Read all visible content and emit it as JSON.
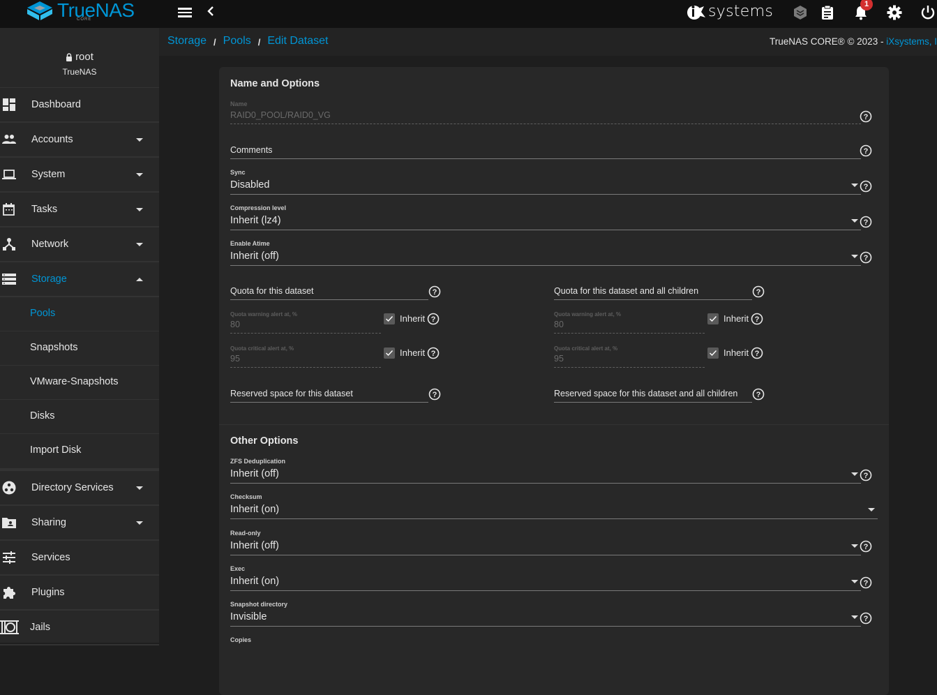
{
  "header": {
    "logo_text": "TrueNAS",
    "logo_sub": "CORE",
    "vendor_text": "systems",
    "notification_count": "1",
    "icons": [
      "menu-icon",
      "back-chevron-icon",
      "truecommand-icon",
      "clipboard-icon",
      "bell-icon",
      "gear-icon",
      "power-icon"
    ]
  },
  "breadcrumb": {
    "items": [
      "Storage",
      "Pools",
      "Edit Dataset"
    ],
    "separator": "/"
  },
  "copyright": {
    "text": "TrueNAS CORE® © 2023 - ",
    "link": "iXsystems, Inc"
  },
  "user": {
    "name": "root",
    "host": "TrueNAS"
  },
  "sidebar": {
    "items": [
      {
        "label": "Dashboard",
        "icon": "dashboard-icon",
        "expandable": false
      },
      {
        "label": "Accounts",
        "icon": "people-icon",
        "expandable": true
      },
      {
        "label": "System",
        "icon": "laptop-icon",
        "expandable": true
      },
      {
        "label": "Tasks",
        "icon": "calendar-icon",
        "expandable": true
      },
      {
        "label": "Network",
        "icon": "network-icon",
        "expandable": true
      },
      {
        "label": "Storage",
        "icon": "storage-icon",
        "expandable": true,
        "expanded": true,
        "active": true
      },
      {
        "label": "Directory Services",
        "icon": "directory-services-icon",
        "expandable": true
      },
      {
        "label": "Sharing",
        "icon": "folder-shared-icon",
        "expandable": true
      },
      {
        "label": "Services",
        "icon": "tune-icon",
        "expandable": false
      },
      {
        "label": "Plugins",
        "icon": "puzzle-icon",
        "expandable": false
      },
      {
        "label": "Jails",
        "icon": "jail-icon",
        "expandable": false
      }
    ],
    "storage_subitems": [
      {
        "label": "Pools",
        "active": true
      },
      {
        "label": "Snapshots"
      },
      {
        "label": "VMware-Snapshots"
      },
      {
        "label": "Disks"
      },
      {
        "label": "Import Disk"
      }
    ]
  },
  "form": {
    "section1_title": "Name and Options",
    "name": {
      "label": "Name",
      "value": "RAID0_POOL/RAID0_VG"
    },
    "comments": {
      "placeholder": "Comments",
      "value": ""
    },
    "sync": {
      "label": "Sync",
      "value": "Disabled"
    },
    "compression": {
      "label": "Compression level",
      "value": "Inherit (lz4)"
    },
    "atime": {
      "label": "Enable Atime",
      "value": "Inherit (off)"
    },
    "quota_left": {
      "placeholder": "Quota for this dataset",
      "warning": {
        "label": "Quota warning alert at, %",
        "value": "80",
        "inherit": true,
        "inherit_label": "Inherit"
      },
      "critical": {
        "label": "Quota critical alert at, %",
        "value": "95",
        "inherit": true,
        "inherit_label": "Inherit"
      },
      "reserved": {
        "placeholder": "Reserved space for this dataset"
      }
    },
    "quota_right": {
      "placeholder": "Quota for this dataset and all children",
      "warning": {
        "label": "Quota warning alert at, %",
        "value": "80",
        "inherit": true,
        "inherit_label": "Inherit"
      },
      "critical": {
        "label": "Quota critical alert at, %",
        "value": "95",
        "inherit": true,
        "inherit_label": "Inherit"
      },
      "reserved": {
        "placeholder": "Reserved space for this dataset and all children"
      }
    },
    "section2_title": "Other Options",
    "dedup": {
      "label": "ZFS Deduplication",
      "value": "Inherit (off)"
    },
    "checksum": {
      "label": "Checksum",
      "value": "Inherit (on)"
    },
    "readonly": {
      "label": "Read-only",
      "value": "Inherit (off)"
    },
    "exec": {
      "label": "Exec",
      "value": "Inherit (on)"
    },
    "snapdir": {
      "label": "Snapshot directory",
      "value": "Invisible"
    },
    "copies": {
      "label": "Copies"
    }
  },
  "colors": {
    "accent": "#0095d5",
    "topbar": "#111111",
    "sidebar": "#282828",
    "background": "#1e1e1e",
    "card": "#282828",
    "badge": "#d32f2f"
  }
}
